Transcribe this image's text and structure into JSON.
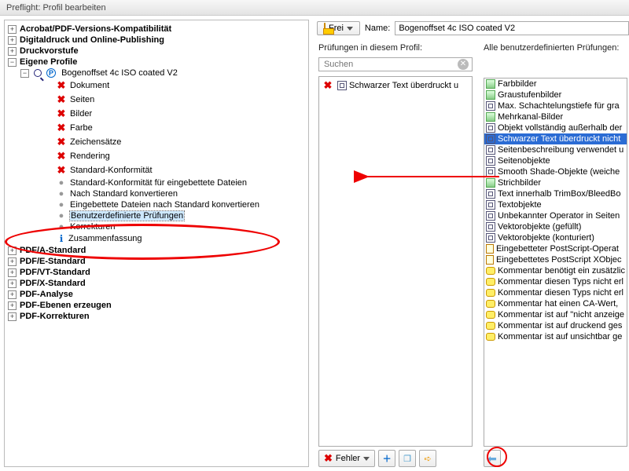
{
  "window_title": "Preflight: Profil bearbeiten",
  "toolbar": {
    "lock_label": "Frei",
    "name_label": "Name:",
    "name_value": "Bogenoffset 4c ISO coated V2"
  },
  "tree": {
    "top": [
      "Acrobat/PDF-Versions-Kompatibilität",
      "Digitaldruck und Online-Publishing",
      "Druckvorstufe"
    ],
    "eigene_label": "Eigene Profile",
    "profile_label": "Bogenoffset 4c ISO coated V2",
    "profile_items": [
      {
        "icon": "x",
        "label": "Dokument"
      },
      {
        "icon": "x",
        "label": "Seiten"
      },
      {
        "icon": "x",
        "label": "Bilder"
      },
      {
        "icon": "x",
        "label": "Farbe"
      },
      {
        "icon": "x",
        "label": "Zeichensätze"
      },
      {
        "icon": "x",
        "label": "Rendering"
      },
      {
        "icon": "x",
        "label": "Standard-Konformität"
      },
      {
        "icon": "g",
        "label": "Standard-Konformität für eingebettete Dateien"
      },
      {
        "icon": "g",
        "label": "Nach Standard konvertieren"
      },
      {
        "icon": "g",
        "label": "Eingebettete Dateien nach Standard konvertieren"
      },
      {
        "icon": "g",
        "label": "Benutzerdefinierte Prüfungen",
        "selected": true
      },
      {
        "icon": "g",
        "label": "Korrekturen"
      },
      {
        "icon": "s",
        "label": "Zusammenfassung"
      }
    ],
    "bottom": [
      "PDF/A-Standard",
      "PDF/E-Standard",
      "PDF/VT-Standard",
      "PDF/X-Standard",
      "PDF-Analyse",
      "PDF-Ebenen erzeugen",
      "PDF-Korrekturen"
    ]
  },
  "middle": {
    "header": "Prüfungen in diesem Profil:",
    "search_placeholder": "Suchen",
    "item": "Schwarzer Text überdruckt u",
    "fehler_label": "Fehler"
  },
  "right": {
    "header": "Alle benutzerdefinierten Prüfungen:",
    "items": [
      {
        "icon": "img",
        "label": "Farbbilder"
      },
      {
        "icon": "img",
        "label": "Graustufenbilder"
      },
      {
        "icon": "mv",
        "label": "Max. Schachtelungstiefe für gra"
      },
      {
        "icon": "img",
        "label": "Mehrkanal-Bilder"
      },
      {
        "icon": "mv",
        "label": "Objekt vollständig außerhalb der"
      },
      {
        "icon": "mv",
        "label": "Schwarzer Text überdruckt nicht",
        "selected": true
      },
      {
        "icon": "mv",
        "label": "Seitenbeschreibung verwendet u"
      },
      {
        "icon": "mv",
        "label": "Seitenobjekte"
      },
      {
        "icon": "mv",
        "label": "Smooth Shade-Objekte (weiche "
      },
      {
        "icon": "img",
        "label": "Strichbilder"
      },
      {
        "icon": "mv",
        "label": "Text innerhalb TrimBox/BleedBo"
      },
      {
        "icon": "mv",
        "label": "Textobjekte"
      },
      {
        "icon": "mv",
        "label": "Unbekannter Operator in Seiten"
      },
      {
        "icon": "mv",
        "label": "Vektorobjekte (gefüllt)"
      },
      {
        "icon": "mv",
        "label": "Vektorobjekte (konturiert)"
      },
      {
        "icon": "doc",
        "label": "Eingebetteter PostScript-Operat"
      },
      {
        "icon": "doc",
        "label": "Eingebettetes PostScript XObjec"
      },
      {
        "icon": "cmt",
        "label": "Kommentar benötigt ein zusätzlic"
      },
      {
        "icon": "cmt",
        "label": "Kommentar diesen Typs nicht erl"
      },
      {
        "icon": "cmt",
        "label": "Kommentar diesen Typs nicht erl"
      },
      {
        "icon": "cmt",
        "label": "Kommentar hat einen CA-Wert, "
      },
      {
        "icon": "cmt",
        "label": "Kommentar ist auf \"nicht anzeige"
      },
      {
        "icon": "cmt",
        "label": "Kommentar ist auf druckend ges"
      },
      {
        "icon": "cmt",
        "label": "Kommentar ist auf unsichtbar ge"
      }
    ]
  }
}
